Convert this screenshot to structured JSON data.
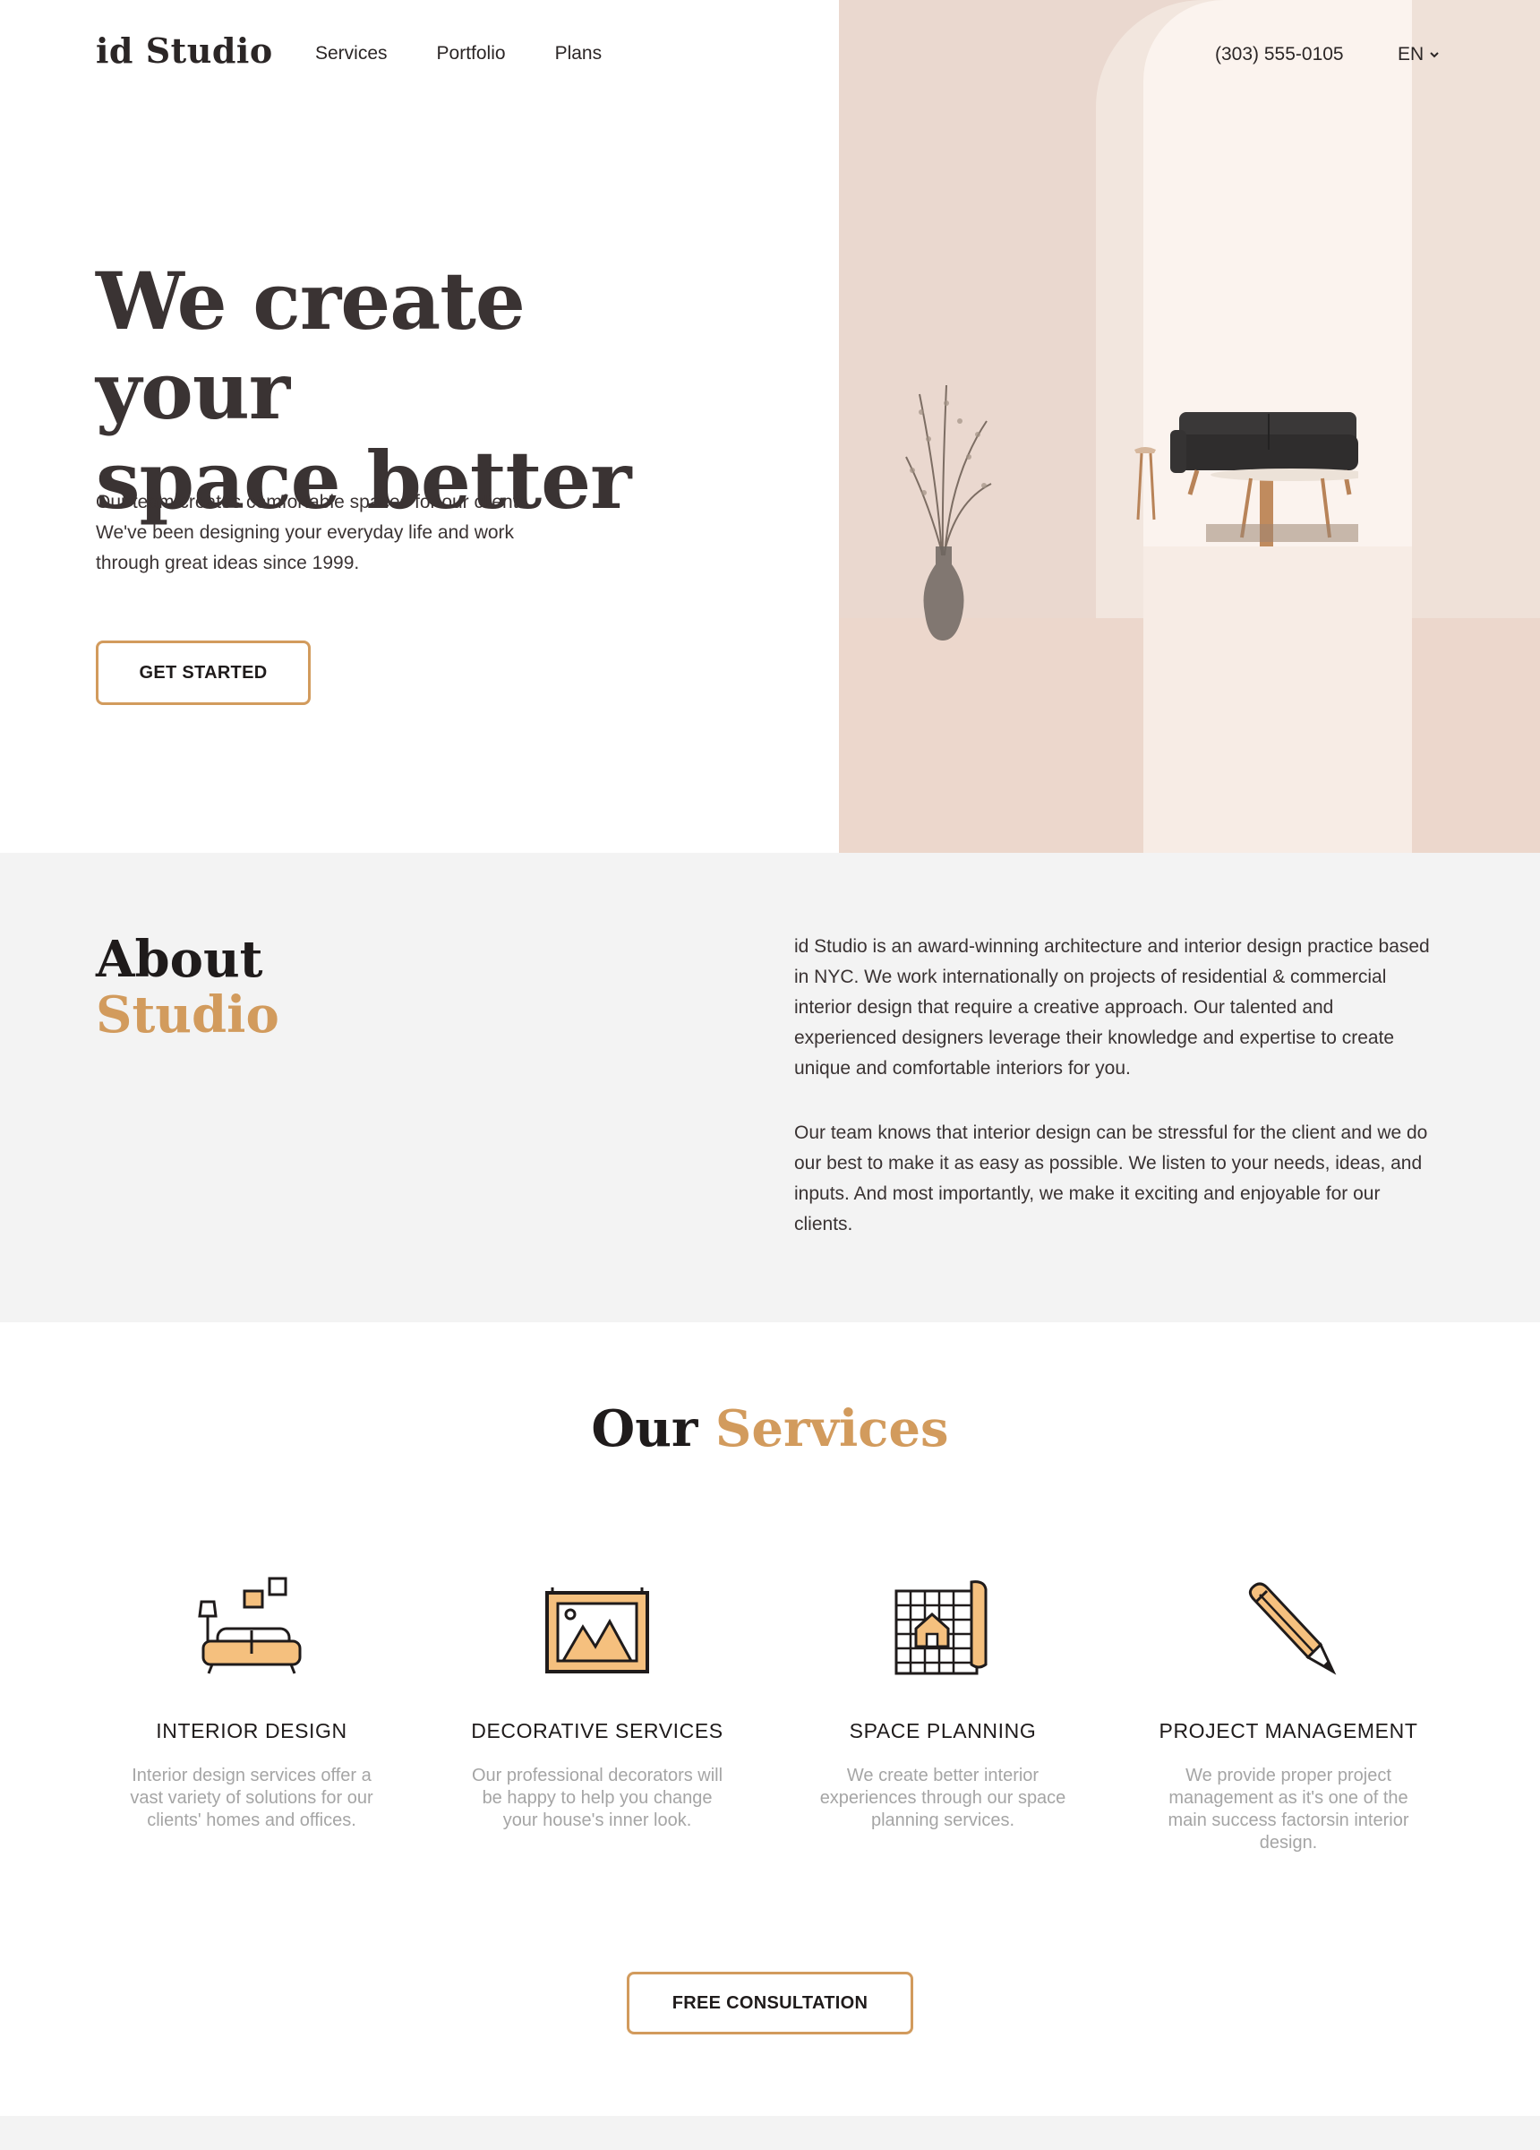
{
  "header": {
    "logo": "id Studio",
    "nav": [
      "Services",
      "Portfolio",
      "Plans"
    ],
    "phone": "(303) 555-0105",
    "language": "EN"
  },
  "hero": {
    "title_line1": "We create your",
    "title_line2": "space better",
    "subtitle": "Our team creates comfortable spaces for our clients. We've been designing your everyday life and work through great ideas since 1999.",
    "cta": "GET STARTED"
  },
  "about": {
    "title": "About",
    "title_accent": "Studio",
    "paragraph1": "id Studio is an award-winning architecture and interior design practice based in NYC. We work internationally on projects of residential & commercial interior design that require a creative approach. Our talented and experienced designers leverage their knowledge and expertise to create unique and comfortable interiors for you.",
    "paragraph2": "Our team knows that interior design can be stressful for the client and we do our best to make it as easy as possible. We listen to your needs, ideas, and inputs. And most importantly, we make it exciting and enjoyable for our clients."
  },
  "services": {
    "title": "Our",
    "title_accent": "Services",
    "items": [
      {
        "title": "INTERIOR DESIGN",
        "description": "Interior design services offer a vast variety of solutions for our clients' homes and offices.",
        "icon": "sofa-icon"
      },
      {
        "title": "DECORATIVE SERVICES",
        "description": "Our professional decorators will be happy to help you change your house's inner look.",
        "icon": "picture-frame-icon"
      },
      {
        "title": "SPACE PLANNING",
        "description": "We create better interior experiences through our space planning services.",
        "icon": "blueprint-icon"
      },
      {
        "title": "PROJECT MANAGEMENT",
        "description": "We provide proper project management as it's one of the main success factorsin interior design.",
        "icon": "pencil-icon"
      }
    ],
    "cta": "FREE CONSULTATION"
  },
  "colors": {
    "accent": "#d29b5d",
    "text": "#2e2a2a",
    "muted": "#a5a5a5",
    "section_bg": "#f3f3f3",
    "hero_image_bg": "#ead8cf"
  }
}
